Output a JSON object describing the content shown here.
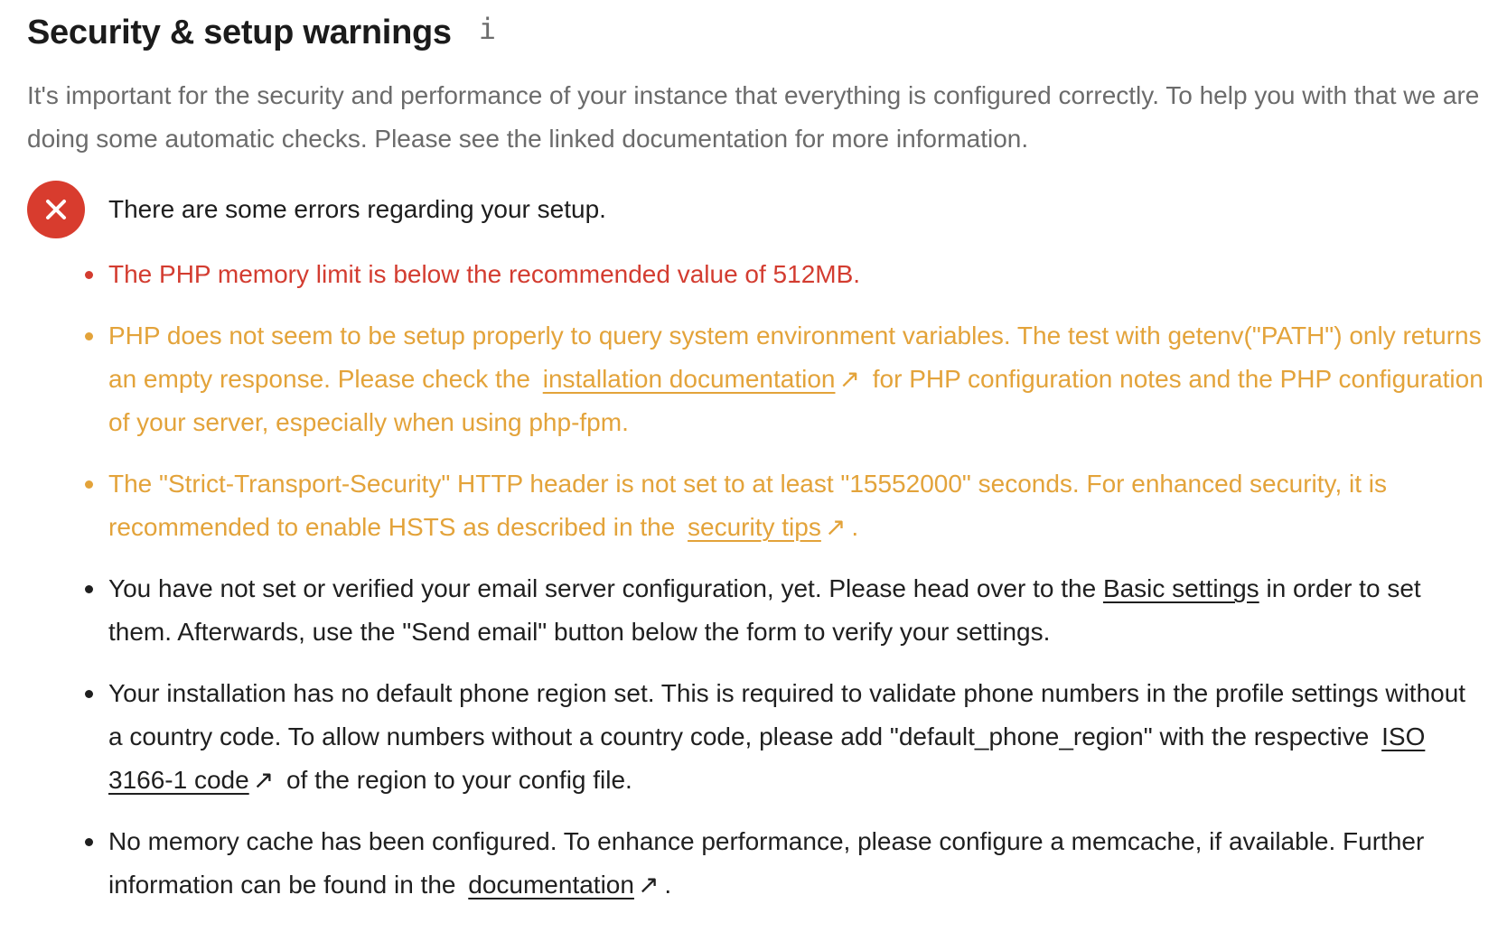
{
  "section": {
    "title": "Security & setup warnings",
    "info_icon": "info-icon",
    "description": "It's important for the security and performance of your instance that everything is configured correctly. To help you with that we are doing some automatic checks. Please see the linked documentation for more information."
  },
  "status": {
    "icon": "close-icon",
    "text": "There are some errors regarding your setup.",
    "badge_color": "#d83c2e"
  },
  "colors": {
    "error": "#d33c30",
    "warning": "#e3a33a",
    "info": "#1f1f1f"
  },
  "warnings": [
    {
      "level": "error",
      "text": "The PHP memory limit is below the recommended value of 512MB."
    },
    {
      "level": "warning",
      "text_before": "PHP does not seem to be setup properly to query system environment variables. The test with getenv(\"PATH\") only returns an empty response. Please check the",
      "link": "installation documentation",
      "link_arrow": "↗",
      "text_after": "for PHP configuration notes and the PHP configuration of your server, especially when using php-fpm."
    },
    {
      "level": "warning",
      "text_before": "The \"Strict-Transport-Security\" HTTP header is not set to at least \"15552000\" seconds. For enhanced security, it is recommended to enable HSTS as described in the",
      "link": "security tips",
      "link_arrow": "↗",
      "text_after": "."
    },
    {
      "level": "info",
      "text_before": "You have not set or verified your email server configuration, yet. Please head over to the",
      "link": "Basic settings",
      "text_after": "in order to set them. Afterwards, use the \"Send email\" button below the form to verify your settings."
    },
    {
      "level": "info",
      "text_before": "Your installation has no default phone region set. This is required to validate phone numbers in the profile settings without a country code. To allow numbers without a country code, please add \"default_phone_region\" with the respective",
      "link": "ISO 3166-1 code",
      "link_arrow": "↗",
      "text_after": "of the region to your config file."
    },
    {
      "level": "info",
      "text_before": "No memory cache has been configured. To enhance performance, please configure a memcache, if available. Further information can be found in the",
      "link": "documentation",
      "link_arrow": "↗",
      "text_after": "."
    }
  ]
}
